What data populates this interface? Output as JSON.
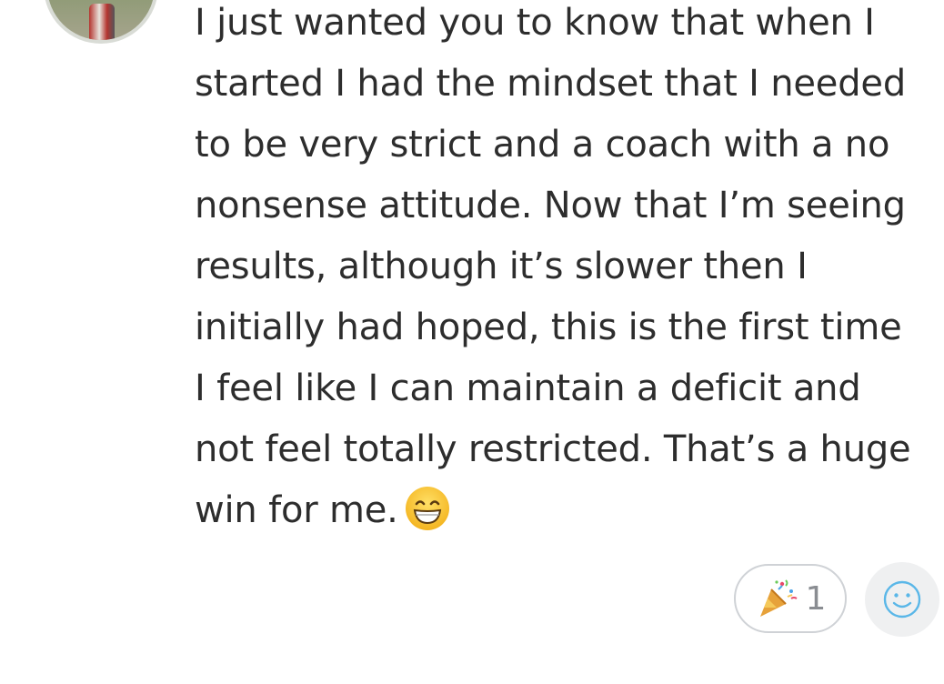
{
  "message": {
    "lines": [
      "I just wanted you to know that when I",
      "started I had the mindset that I needed",
      "to be very strict and a coach with a no",
      "nonsense attitude. Now that I’m seeing",
      "results, although it’s slower then I",
      "initially had hoped, this is the first time",
      "I feel like I can maintain a deficit and",
      "not feel totally restricted. That’s a huge",
      "win for me."
    ],
    "trailing_emoji": "grinning-face-icon"
  },
  "reactions": [
    {
      "icon": "party-popper-icon",
      "count": "1"
    }
  ],
  "add_reaction": {
    "icon": "smiley-icon",
    "accent_color": "#5ab7e8"
  }
}
